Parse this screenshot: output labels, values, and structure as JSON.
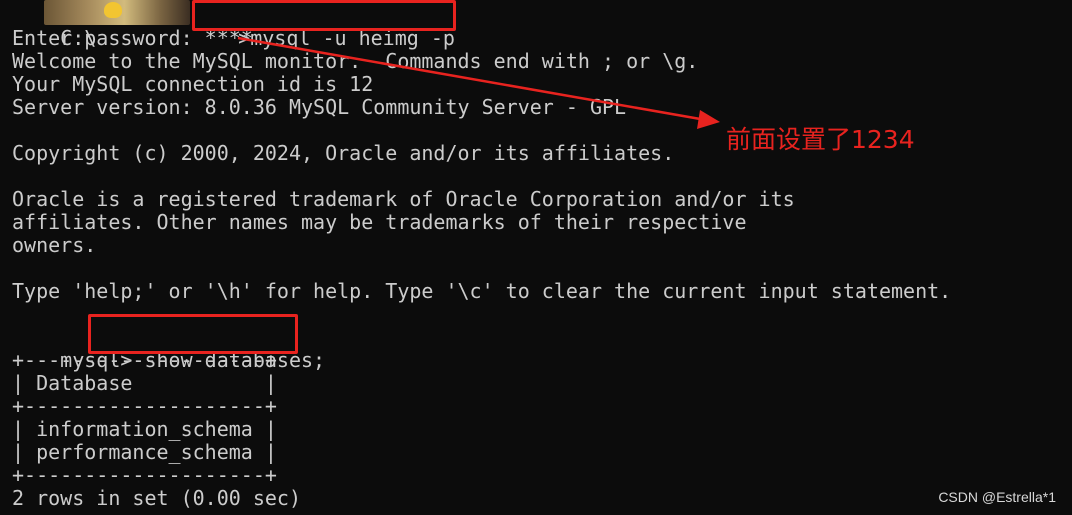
{
  "terminal": {
    "prompt_start": "C:\\",
    "prompt_end": ">",
    "login_command": "mysql -u heimg -p",
    "lines": [
      "Enter password: ****",
      "Welcome to the MySQL monitor.  Commands end with ; or \\g.",
      "Your MySQL connection id is 12",
      "Server version: 8.0.36 MySQL Community Server - GPL",
      "",
      "Copyright (c) 2000, 2024, Oracle and/or its affiliates.",
      "",
      "Oracle is a registered trademark of Oracle Corporation and/or its",
      "affiliates. Other names may be trademarks of their respective",
      "owners.",
      "",
      "Type 'help;' or '\\h' for help. Type '\\c' to clear the current input statement.",
      ""
    ],
    "mysql_prompt": "mysql> ",
    "query": "show databases;",
    "result_lines": [
      "+--------------------+",
      "| Database           |",
      "+--------------------+",
      "| information_schema |",
      "| performance_schema |",
      "+--------------------+",
      "2 rows in set (0.00 sec)"
    ]
  },
  "annotation": {
    "text": "前面设置了1234",
    "color": "#e8231f"
  },
  "watermark": "CSDN @Estrella*1"
}
